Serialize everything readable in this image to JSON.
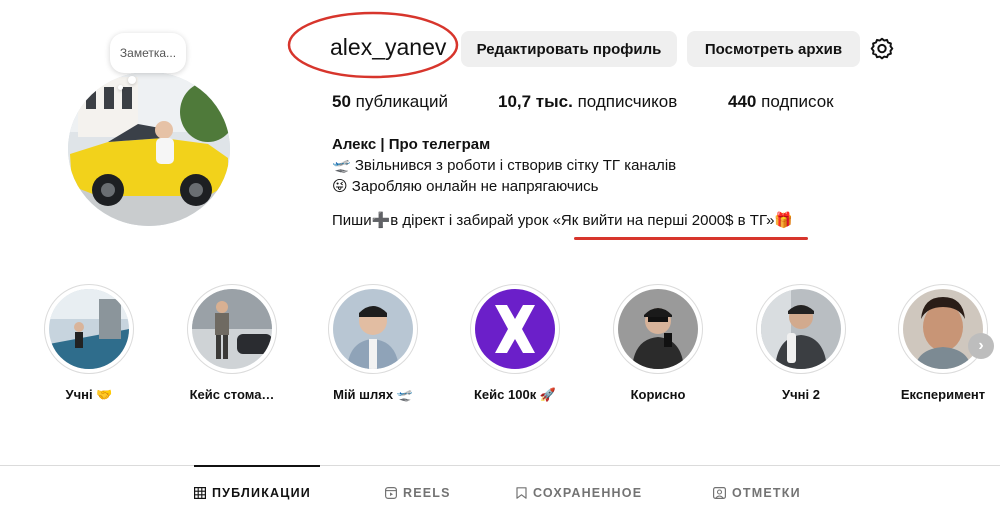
{
  "profile": {
    "note_bubble": "Заметка...",
    "username": "alex_yanev",
    "edit_profile": "Редактировать профиль",
    "view_archive": "Посмотреть архив",
    "stats": {
      "posts_count": "50",
      "posts_label": "публикаций",
      "followers_count": "10,7 тыс.",
      "followers_label": "подписчиков",
      "following_count": "440",
      "following_label": "подписок"
    },
    "bio": {
      "name": "Алекс | Про телеграм",
      "line1": "🛫 Звільнився з роботи і створив сітку ТГ каналів",
      "line2": "😜 Заробляю онлайн не напрягаючись",
      "cta_prefix": "Пиши➕в дірект і забирай урок ",
      "cta_highlight": "«Як вийти на перші 2000$ в ТГ»🎁"
    }
  },
  "stories": [
    {
      "label": "Учні 🤝",
      "color": "#2f6d8c"
    },
    {
      "label": "Кейс стома…",
      "color": "#7d7f84"
    },
    {
      "label": "Мій шлях 🛫",
      "color": "#8fa3b8"
    },
    {
      "label": "Кейс 100к 🚀",
      "color": "#6b1fc9"
    },
    {
      "label": "Корисно",
      "color": "#5a5a5a"
    },
    {
      "label": "Учні 2",
      "color": "#6f7478"
    },
    {
      "label": "Експеримент",
      "color": "#b07a62"
    }
  ],
  "tabs": [
    {
      "label": "ПУБЛИКАЦИИ",
      "icon": "grid-icon",
      "active": true
    },
    {
      "label": "REELS",
      "icon": "reels-icon",
      "active": false
    },
    {
      "label": "СОХРАНЕННОЕ",
      "icon": "bookmark-icon",
      "active": false
    },
    {
      "label": "ОТМЕТКИ",
      "icon": "tagged-icon",
      "active": false
    }
  ],
  "colors": {
    "annotation_red": "#d7352c",
    "button_bg": "#efefef",
    "tab_inactive": "#737373"
  }
}
